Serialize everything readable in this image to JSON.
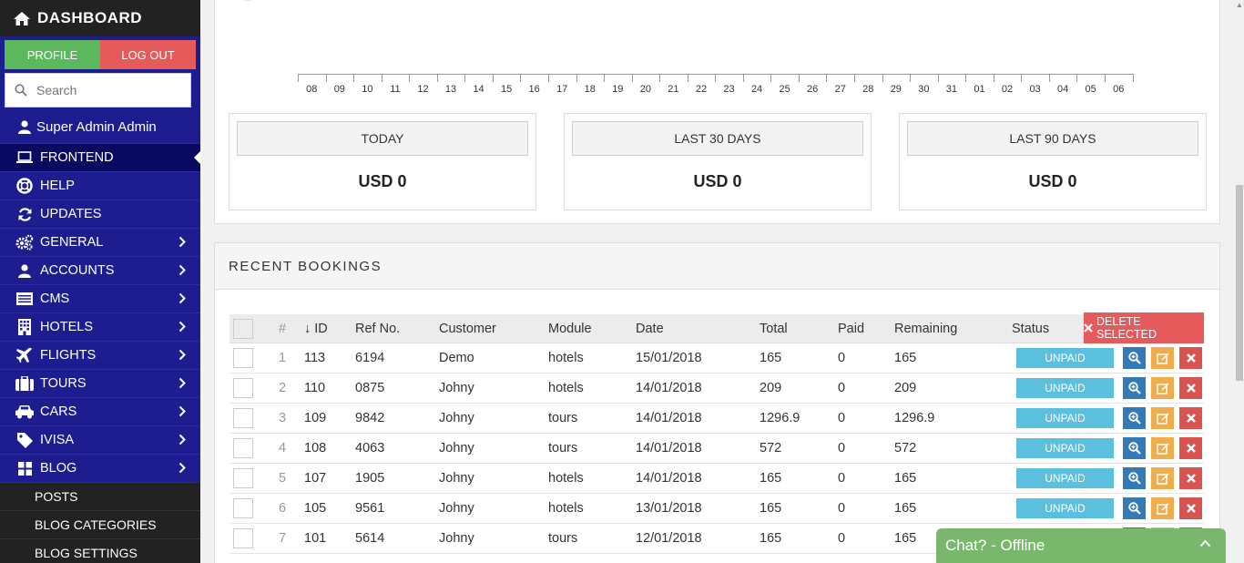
{
  "sidebar": {
    "title": "DASHBOARD",
    "profile_label": "PROFILE",
    "logout_label": "LOG OUT",
    "search_placeholder": "Search",
    "user_name": "Super Admin Admin",
    "items": [
      {
        "label": "FRONTEND",
        "icon": "laptop-icon",
        "active": true
      },
      {
        "label": "HELP",
        "icon": "lifebuoy-icon"
      },
      {
        "label": "UPDATES",
        "icon": "refresh-icon"
      },
      {
        "label": "GENERAL",
        "icon": "gears-icon",
        "chevron": true
      },
      {
        "label": "ACCOUNTS",
        "icon": "user-icon",
        "chevron": true
      },
      {
        "label": "CMS",
        "icon": "cms-icon",
        "chevron": true
      },
      {
        "label": "HOTELS",
        "icon": "building-icon",
        "chevron": true
      },
      {
        "label": "FLIGHTS",
        "icon": "plane-icon",
        "chevron": true
      },
      {
        "label": "TOURS",
        "icon": "suitcase-icon",
        "chevron": true
      },
      {
        "label": "CARS",
        "icon": "car-icon",
        "chevron": true
      },
      {
        "label": "IVISA",
        "icon": "tag-icon",
        "chevron": true
      },
      {
        "label": "BLOG",
        "icon": "grid-icon",
        "chevron": true
      }
    ],
    "subitems": [
      "POSTS",
      "BLOG CATEGORIES",
      "BLOG SETTINGS"
    ]
  },
  "chart": {
    "ylabel_fragment": "B",
    "x_ticks": [
      "08",
      "09",
      "10",
      "11",
      "12",
      "13",
      "14",
      "15",
      "16",
      "17",
      "18",
      "19",
      "20",
      "21",
      "22",
      "23",
      "24",
      "25",
      "26",
      "27",
      "28",
      "29",
      "30",
      "31",
      "01",
      "02",
      "03",
      "04",
      "05",
      "06"
    ]
  },
  "stats": [
    {
      "title": "TODAY",
      "value": "USD 0"
    },
    {
      "title": "LAST 30 DAYS",
      "value": "USD 0"
    },
    {
      "title": "LAST 90 DAYS",
      "value": "USD 0"
    }
  ],
  "bookings": {
    "title": "RECENT BOOKINGS",
    "headers": {
      "num": "#",
      "id": "↓ ID",
      "ref": "Ref No.",
      "customer": "Customer",
      "module": "Module",
      "date": "Date",
      "total": "Total",
      "paid": "Paid",
      "remaining": "Remaining",
      "status": "Status"
    },
    "delete_label": "DELETE SELECTED",
    "rows": [
      {
        "num": "1",
        "id": "113",
        "ref": "6194",
        "customer": "Demo",
        "module": "hotels",
        "date": "15/01/2018",
        "total": "165",
        "paid": "0",
        "remaining": "165",
        "status": "UNPAID"
      },
      {
        "num": "2",
        "id": "110",
        "ref": "0875",
        "customer": "Johny",
        "module": "hotels",
        "date": "14/01/2018",
        "total": "209",
        "paid": "0",
        "remaining": "209",
        "status": "UNPAID"
      },
      {
        "num": "3",
        "id": "109",
        "ref": "9842",
        "customer": "Johny",
        "module": "tours",
        "date": "14/01/2018",
        "total": "1296.9",
        "paid": "0",
        "remaining": "1296.9",
        "status": "UNPAID"
      },
      {
        "num": "4",
        "id": "108",
        "ref": "4063",
        "customer": "Johny",
        "module": "tours",
        "date": "14/01/2018",
        "total": "572",
        "paid": "0",
        "remaining": "572",
        "status": "UNPAID"
      },
      {
        "num": "5",
        "id": "107",
        "ref": "1905",
        "customer": "Johny",
        "module": "hotels",
        "date": "14/01/2018",
        "total": "165",
        "paid": "0",
        "remaining": "165",
        "status": "UNPAID"
      },
      {
        "num": "6",
        "id": "105",
        "ref": "9561",
        "customer": "Johny",
        "module": "hotels",
        "date": "13/01/2018",
        "total": "165",
        "paid": "0",
        "remaining": "165",
        "status": "UNPAID"
      },
      {
        "num": "7",
        "id": "101",
        "ref": "5614",
        "customer": "Johny",
        "module": "tours",
        "date": "12/01/2018",
        "total": "165",
        "paid": "0",
        "remaining": "165",
        "status": ""
      }
    ]
  },
  "chat": {
    "label": "Chat? - Offline"
  },
  "colors": {
    "sidebar": "#1d1d8f",
    "profile": "#5cb85c",
    "logout": "#e55a5a",
    "unpaid": "#5bc0de",
    "chat": "#79b86c"
  }
}
